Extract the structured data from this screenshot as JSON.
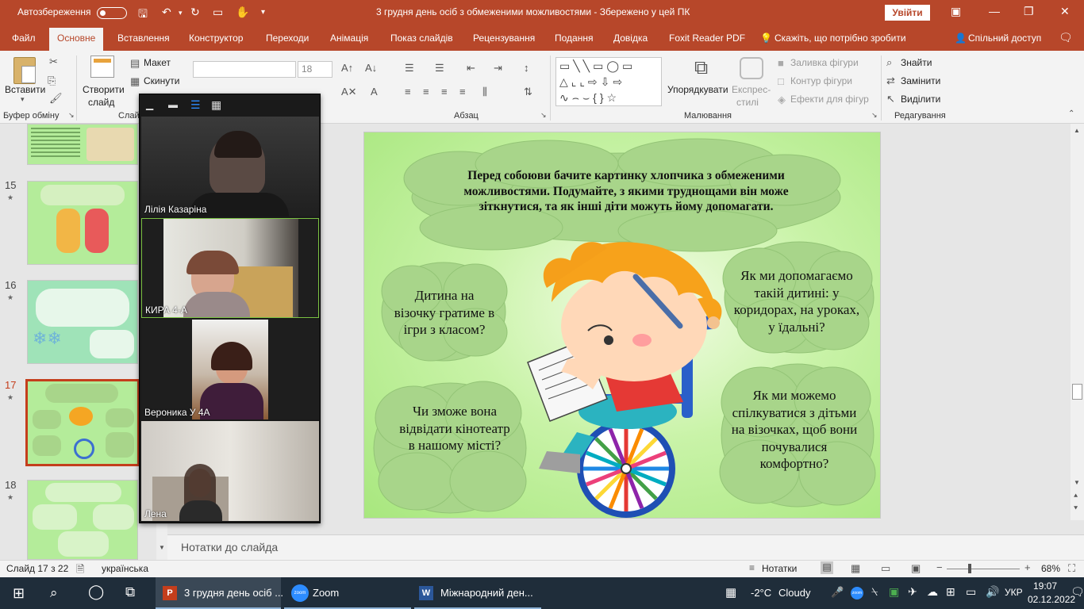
{
  "titlebar": {
    "autosave_label": "Автозбереження",
    "autosave_state": "off",
    "document_title": "3 грудня день осіб з обмеженими можливостями  -  Збережено у цей ПК",
    "signin_label": "Увійти"
  },
  "tabs": [
    "Файл",
    "Основне",
    "Вставлення",
    "Конструктор",
    "Переходи",
    "Анімація",
    "Показ слайдів",
    "Рецензування",
    "Подання",
    "Довідка",
    "Foxit Reader PDF"
  ],
  "active_tab": "Основне",
  "tell_me": "Скажіть, що потрібно зробити",
  "share_label": "Спільний доступ",
  "ribbon": {
    "paste": "Вставити",
    "clipboard_group": "Буфер обміну",
    "new_slide_1": "Створити",
    "new_slide_2": "слайд",
    "layout": "Макет",
    "reset": "Скинути",
    "slides_group": "Слайди",
    "font_size": "18",
    "paragraph_group": "Абзац",
    "arrange": "Упорядкувати",
    "quick_styles_1": "Експрес-",
    "quick_styles_2": "стилі",
    "shape_fill": "Заливка фігури",
    "shape_outline": "Контур фігури",
    "shape_effects": "Ефекти для фігур",
    "drawing_group": "Малювання",
    "find": "Знайти",
    "replace": "Замінити",
    "select": "Виділити",
    "editing_group": "Редагування"
  },
  "thumbnails": [
    {
      "num": "15",
      "selected": false
    },
    {
      "num": "16",
      "selected": false
    },
    {
      "num": "17",
      "selected": true
    },
    {
      "num": "18",
      "selected": false
    }
  ],
  "slide": {
    "top_text": "Перед собоюви бачите картинку хлопчика з обмеженими можливостями. Подумайте, з якими труднощами він може зіткнутися, та як інші діти можуть йому допомагати.",
    "left_top": "Дитина на візочку гратиме в ігри з класом?",
    "right_top": "Як ми допомагаємо такій дитині: у коридорах, на уроках, у їдальні?",
    "left_bottom": "Чи зможе вона відвідати кінотеатр в нашому місті?",
    "right_bottom": "Як ми можемо спілкуватися з дітьми на візочках, щоб вони почувалися комфортно?"
  },
  "notes_placeholder": "Нотатки до слайда",
  "status": {
    "slide_info": "Слайд 17 з 22",
    "language": "українська",
    "notes_label": "Нотатки",
    "zoom_level": "68%"
  },
  "zoom_participants": [
    {
      "name": "Лілія Казаріна",
      "active": false
    },
    {
      "name": "КИРА 4-А",
      "active": true
    },
    {
      "name": "Вероника У 4А",
      "active": false
    },
    {
      "name": "Лена",
      "active": false
    }
  ],
  "taskbar": {
    "apps": [
      "3 грудня день осіб ...",
      "Zoom",
      "Міжнародний ден..."
    ],
    "weather_temp": "-2°C",
    "weather_desc": "Cloudy",
    "lang": "УКР",
    "time": "19:07",
    "date": "02.12.2022"
  },
  "colors": {
    "ppt_accent": "#b7472a",
    "slide_bg": "#b4ec9a",
    "cloud": "#a8d58a",
    "taskbar": "#1f2d3a"
  }
}
